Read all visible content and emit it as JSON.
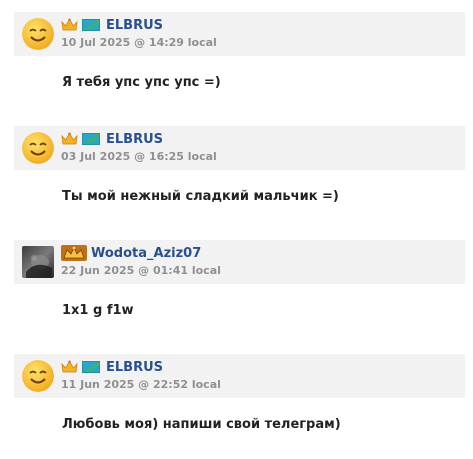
{
  "posts": [
    {
      "username": "ELBRUS",
      "timestamp": "10 Jul 2025 @ 14:29 local",
      "message": "Я тебя упс упс упс =)",
      "avatar": "smiley-face",
      "badges": [
        "crown-icon",
        "flag-icon"
      ]
    },
    {
      "username": "ELBRUS",
      "timestamp": "03 Jul 2025 @ 16:25 local",
      "message": "Ты мой нежный сладкий мальчик =)",
      "avatar": "smiley-face",
      "badges": [
        "crown-icon",
        "flag-icon"
      ]
    },
    {
      "username": "Wodota_Aziz07",
      "timestamp": "22 Jun 2025 @ 01:41 local",
      "message": "1x1 g f1w",
      "avatar": "dark-photo",
      "badges": [
        "rank-icon"
      ]
    },
    {
      "username": "ELBRUS",
      "timestamp": "11 Jun 2025 @ 22:52 local",
      "message": "Любовь моя) напиши свой телеграм)",
      "avatar": "smiley-face",
      "badges": [
        "crown-icon",
        "flag-icon"
      ]
    }
  ],
  "colors": {
    "username": "#2a4f8f",
    "header_bg": "#f2f2f2",
    "timestamp": "#909090",
    "message": "#222222"
  }
}
